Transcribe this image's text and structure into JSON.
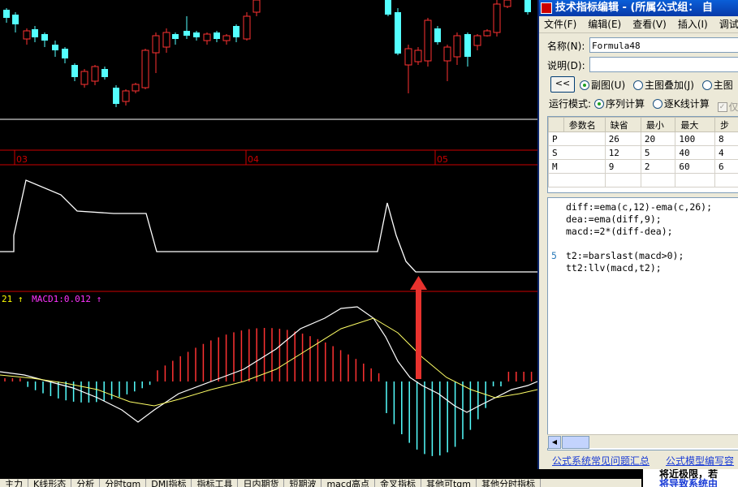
{
  "chart": {
    "date_labels": [
      "03",
      "04",
      "05"
    ],
    "indicator_values": [
      "21",
      "MACD1:0.012"
    ],
    "up_arrow_glyph": "↑",
    "colors": {
      "up_candle": "#ff3232",
      "down_candle": "#54ffff",
      "red_line": "#cc0000",
      "macd_white": "#ffffff",
      "macd_yellow": "#ffff66",
      "label_yellow": "#ffff00",
      "label_magenta": "#ff33ff",
      "arrow_red": "#e8322e"
    }
  },
  "editor": {
    "title": "技术指标编辑 - (所属公式组： 自",
    "menu": [
      "文件(F)",
      "编辑(E)",
      "查看(V)",
      "插入(I)",
      "调试"
    ],
    "name_label": "名称(N):",
    "name_value": "Formula48",
    "desc_label": "说明(D):",
    "desc_value": "",
    "collapse_button": "<<",
    "chart_type_options": [
      {
        "label": "副图(U)",
        "selected": true
      },
      {
        "label": "主图叠加(J)",
        "selected": false
      },
      {
        "label": "主图",
        "selected": false
      }
    ],
    "run_mode_label": "运行模式:",
    "run_mode_options": [
      {
        "label": "序列计算",
        "selected": true
      },
      {
        "label": "逐K线计算",
        "selected": false
      }
    ],
    "only_label": "仅",
    "params_headers": [
      "参数名",
      "缺省",
      "最小",
      "最大",
      "步"
    ],
    "params_rows": [
      [
        "P",
        "26",
        "20",
        "100",
        "8"
      ],
      [
        "S",
        "12",
        "5",
        "40",
        "4"
      ],
      [
        "M",
        "9",
        "2",
        "60",
        "6"
      ]
    ],
    "code_lines": [
      {
        "num": "",
        "text": "diff:=ema(c,12)-ema(c,26);"
      },
      {
        "num": "",
        "text": "dea:=ema(diff,9);"
      },
      {
        "num": "",
        "text": "macd:=2*(diff-dea);"
      },
      {
        "num": "",
        "text": ""
      },
      {
        "num": "5",
        "text": "t2:=barslast(macd>0);"
      },
      {
        "num": "",
        "text": "tt2:llv(macd,t2);"
      }
    ],
    "links": [
      "公式系统常见问题汇总",
      "公式模型编写容"
    ]
  },
  "bottom_tabs": [
    "主力",
    "K线形态",
    "分析",
    "分时tgm",
    "DMI指标",
    "指标工具",
    "日内期货",
    "短期波",
    "macd高点",
    "金叉指标",
    "其他可tgm",
    "其他分时指标"
  ],
  "notice": {
    "line1": "将近极限，若",
    "line2": "将导致系统由"
  }
}
